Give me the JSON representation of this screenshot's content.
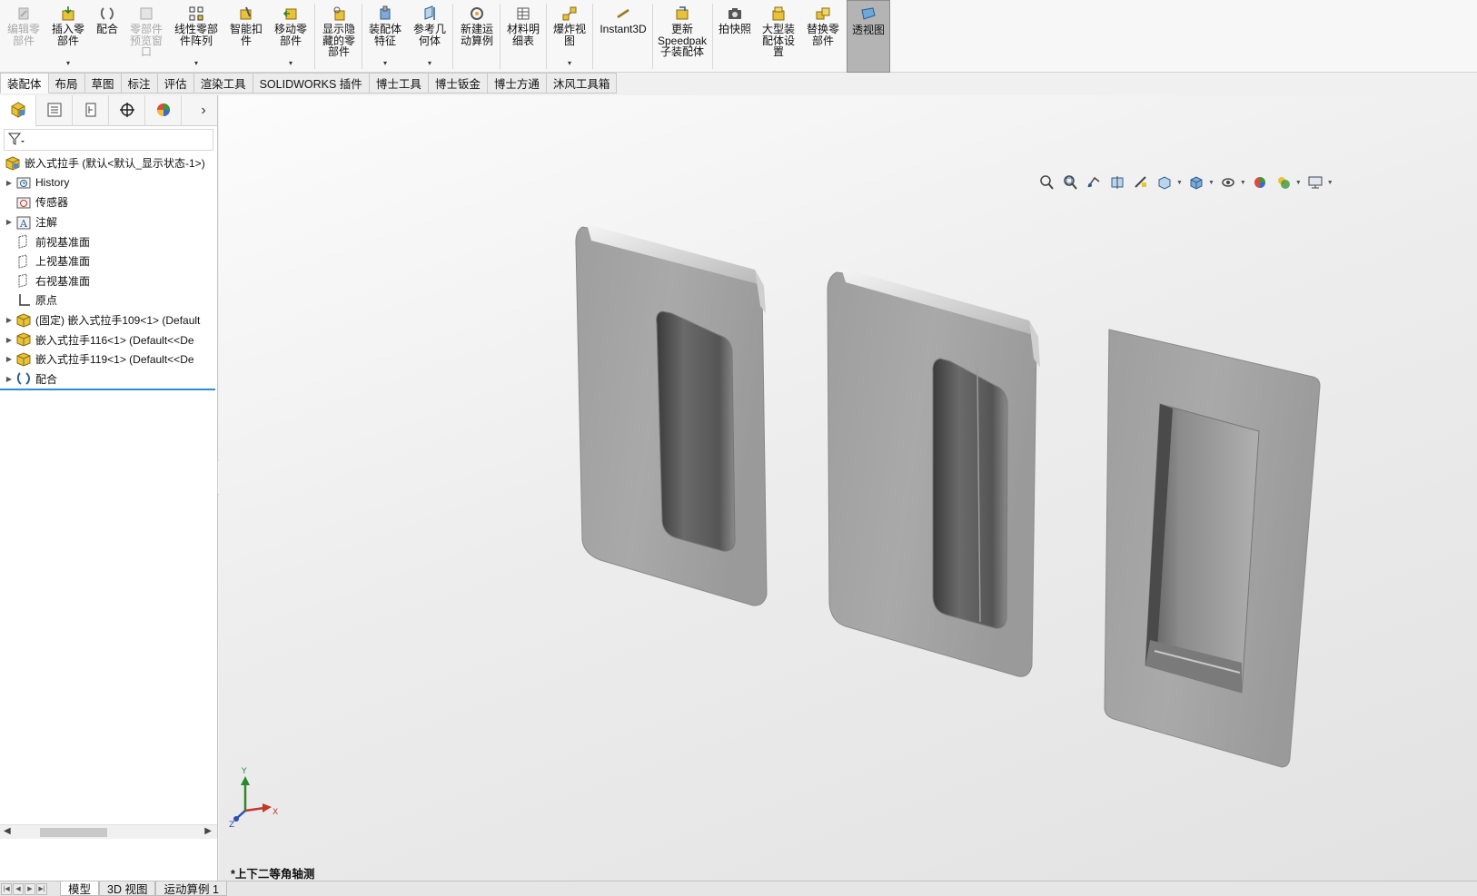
{
  "ribbon": {
    "buttons": [
      {
        "label": "编辑零\n部件",
        "icon": "edit-component-icon",
        "disabled": true
      },
      {
        "label": "插入零\n部件",
        "icon": "insert-component-icon",
        "dropdown": true
      },
      {
        "label": "配合",
        "icon": "mate-icon"
      },
      {
        "label": "零部件\n预览窗\n口",
        "icon": "component-preview-icon",
        "disabled": true
      },
      {
        "label": "线性零部\n件阵列",
        "icon": "linear-pattern-icon",
        "dropdown": true
      },
      {
        "label": "智能扣\n件",
        "icon": "smart-fastener-icon"
      },
      {
        "label": "移动零\n部件",
        "icon": "move-component-icon",
        "dropdown": true
      },
      {
        "label": "显示隐\n藏的零\n部件",
        "icon": "show-hidden-icon"
      },
      {
        "label": "装配体\n特征",
        "icon": "assembly-feature-icon",
        "dropdown": true
      },
      {
        "label": "参考几\n何体",
        "icon": "reference-geometry-icon",
        "dropdown": true
      },
      {
        "label": "新建运\n动算例",
        "icon": "motion-study-icon"
      },
      {
        "label": "材料明\n细表",
        "icon": "bom-icon"
      },
      {
        "label": "爆炸视\n图",
        "icon": "exploded-view-icon",
        "dropdown": true
      },
      {
        "label": "Instant3D",
        "icon": "instant3d-icon"
      },
      {
        "label": "更新\nSpeedpak\n子装配体",
        "icon": "speedpak-icon"
      },
      {
        "label": "拍快照",
        "icon": "snapshot-icon"
      },
      {
        "label": "大型装\n配体设\n置",
        "icon": "large-assembly-icon"
      },
      {
        "label": "替换零\n部件",
        "icon": "replace-component-icon"
      },
      {
        "label": "透视图",
        "icon": "perspective-icon",
        "active": true
      }
    ]
  },
  "command_tabs": [
    "装配体",
    "布局",
    "草图",
    "标注",
    "评估",
    "渲染工具",
    "SOLIDWORKS 插件",
    "博士工具",
    "博士钣金",
    "博士方通",
    "沐风工具箱"
  ],
  "panel": {
    "tabs": [
      "feature-manager-icon",
      "property-manager-icon",
      "configuration-manager-icon",
      "dimxpert-icon",
      "display-manager-icon"
    ],
    "tree": [
      {
        "text": "嵌入式拉手 (默认<默认_显示状态-1>)",
        "icon": "assembly-icon",
        "expand": false,
        "level": 0
      },
      {
        "text": "History",
        "icon": "history-folder-icon",
        "expand": true,
        "level": 1
      },
      {
        "text": "传感器",
        "icon": "sensor-icon",
        "expand": false,
        "level": 1
      },
      {
        "text": "注解",
        "icon": "annotation-icon",
        "expand": true,
        "level": 1
      },
      {
        "text": "前视基准面",
        "icon": "plane-icon",
        "expand": false,
        "level": 1
      },
      {
        "text": "上视基准面",
        "icon": "plane-icon",
        "expand": false,
        "level": 1
      },
      {
        "text": "右视基准面",
        "icon": "plane-icon",
        "expand": false,
        "level": 1
      },
      {
        "text": "原点",
        "icon": "origin-icon",
        "expand": false,
        "level": 1
      },
      {
        "text": "(固定) 嵌入式拉手109<1> (Default",
        "icon": "part-icon",
        "expand": true,
        "level": 1
      },
      {
        "text": "嵌入式拉手116<1> (Default<<De",
        "icon": "part-icon",
        "expand": true,
        "level": 1
      },
      {
        "text": "嵌入式拉手119<1> (Default<<De",
        "icon": "part-icon",
        "expand": true,
        "level": 1
      },
      {
        "text": "配合",
        "icon": "mates-folder-icon",
        "expand": true,
        "level": 1
      }
    ]
  },
  "viewport": {
    "view_name": "*上下二等角轴测",
    "triad": {
      "x": "X",
      "y": "Y",
      "z": "Z"
    },
    "headsup_icons": [
      "zoom-to-fit-icon",
      "zoom-area-icon",
      "previous-view-icon",
      "section-view-icon",
      "dynamic-annotation-icon",
      "view-orientation-icon",
      "display-style-icon",
      "hide-show-icon",
      "edit-appearance-icon",
      "scene-icon",
      "view-settings-icon"
    ]
  },
  "bottom_tabs": [
    {
      "label": "模型",
      "active": true
    },
    {
      "label": "3D 视图",
      "active": false
    },
    {
      "label": "运动算例 1",
      "active": false
    }
  ]
}
